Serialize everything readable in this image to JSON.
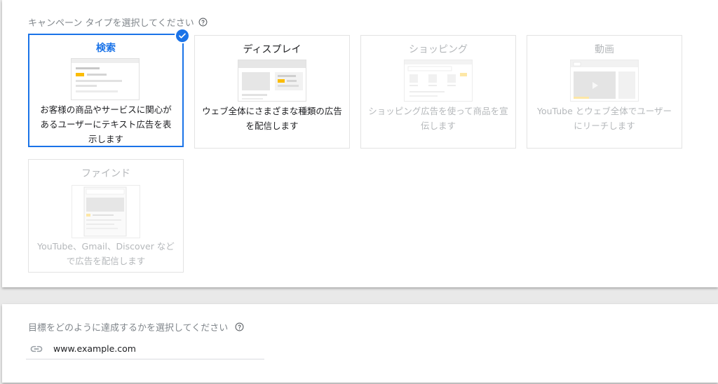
{
  "campaign_type_section": {
    "title": "キャンペーン タイプを選択してください",
    "cards": [
      {
        "title": "検索",
        "description": "お客様の商品やサービスに関心があるユーザーにテキスト広告を表示します",
        "state": "selected"
      },
      {
        "title": "ディスプレイ",
        "description": "ウェブ全体にさまざまな種類の広告を配信します",
        "state": "enabled"
      },
      {
        "title": "ショッピング",
        "description": "ショッピング広告を使って商品を宣伝します",
        "state": "disabled"
      },
      {
        "title": "動画",
        "description": "YouTube とウェブ全体でユーザーにリーチします",
        "state": "disabled"
      },
      {
        "title": "ファインド",
        "description": "YouTube、Gmail、Discover などで広告を配信します",
        "state": "disabled"
      }
    ]
  },
  "goal_section": {
    "title": "目標をどのように達成するかを選択してください",
    "url_value": "www.example.com"
  },
  "icons": {
    "help": "help-circle-icon",
    "check": "check-icon",
    "link": "link-icon"
  },
  "colors": {
    "accent": "#1a73e8",
    "ad_highlight": "#fbbc04",
    "muted_text": "#80868b",
    "disabled_text": "#b5b8bb"
  }
}
